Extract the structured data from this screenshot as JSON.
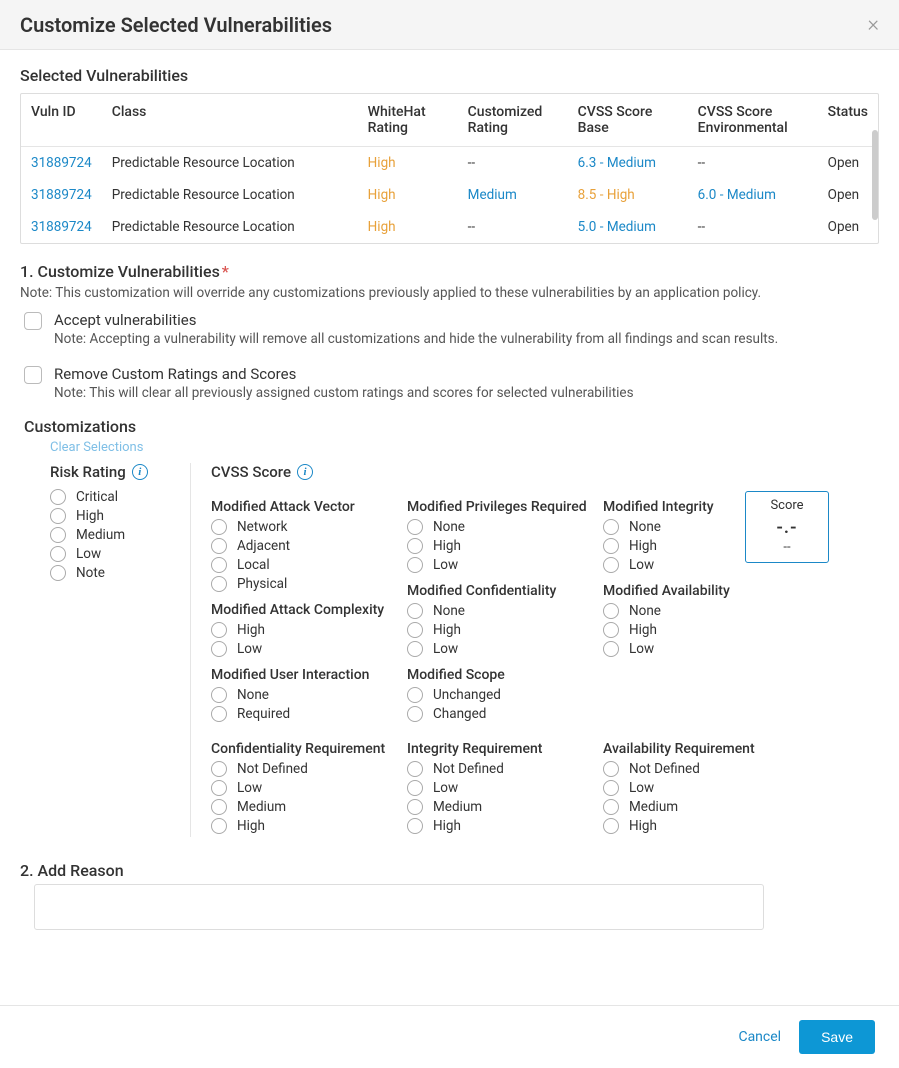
{
  "dialog_title": "Customize Selected Vulnerabilities",
  "selected_heading": "Selected Vulnerabilities",
  "table": {
    "headers": {
      "vuln_id": "Vuln ID",
      "class": "Class",
      "whitehat_rating": "WhiteHat Rating",
      "customized_rating": "Customized Rating",
      "cvss_base": "CVSS Score Base",
      "cvss_env": "CVSS Score Environmental",
      "status": "Status"
    },
    "rows": [
      {
        "id": "31889724",
        "class": "Predictable Resource Location",
        "wh": "High",
        "cust": "--",
        "base": "6.3 - Medium",
        "env": "--",
        "status": "Open"
      },
      {
        "id": "31889724",
        "class": "Predictable Resource Location",
        "wh": "High",
        "cust": "Medium",
        "base": "8.5 - High",
        "env": "6.0 - Medium",
        "status": "Open"
      },
      {
        "id": "31889724",
        "class": "Predictable Resource Location",
        "wh": "High",
        "cust": "--",
        "base": "5.0 - Medium",
        "env": "--",
        "status": "Open"
      }
    ]
  },
  "step1_title": "1. Customize Vulnerabilities",
  "step1_note": "Note: This customization will override any customizations previously applied to these vulnerabilities by an application policy.",
  "accept": {
    "label": "Accept vulnerabilities",
    "note": "Note:  Accepting a vulnerability will remove all customizations and hide the vulnerability from all findings and scan results."
  },
  "remove": {
    "label": "Remove Custom Ratings and Scores",
    "note": "Note:  This will clear all previously assigned custom ratings and scores for selected vulnerabilities"
  },
  "customizations_heading": "Customizations",
  "clear_selections": "Clear Selections",
  "risk_rating_title": "Risk Rating",
  "risk_options": [
    "Critical",
    "High",
    "Medium",
    "Low",
    "Note"
  ],
  "cvss_title": "CVSS Score",
  "score_box": {
    "label": "Score",
    "value": "-.-",
    "sub": "--"
  },
  "metrics": {
    "mav": {
      "title": "Modified Attack Vector",
      "opts": [
        "Network",
        "Adjacent",
        "Local",
        "Physical"
      ]
    },
    "mac": {
      "title": "Modified Attack Complexity",
      "opts": [
        "High",
        "Low"
      ]
    },
    "mui": {
      "title": "Modified User Interaction",
      "opts": [
        "None",
        "Required"
      ]
    },
    "mpr": {
      "title": "Modified Privileges Required",
      "opts": [
        "None",
        "High",
        "Low"
      ]
    },
    "mc": {
      "title": "Modified Confidentiality",
      "opts": [
        "None",
        "High",
        "Low"
      ]
    },
    "ms": {
      "title": "Modified Scope",
      "opts": [
        "Unchanged",
        "Changed"
      ]
    },
    "mi": {
      "title": "Modified Integrity",
      "opts": [
        "None",
        "High",
        "Low"
      ]
    },
    "ma": {
      "title": "Modified Availability",
      "opts": [
        "None",
        "High",
        "Low"
      ]
    },
    "cr": {
      "title": "Confidentiality Requirement",
      "opts": [
        "Not Defined",
        "Low",
        "Medium",
        "High"
      ]
    },
    "ir": {
      "title": "Integrity Requirement",
      "opts": [
        "Not Defined",
        "Low",
        "Medium",
        "High"
      ]
    },
    "ar": {
      "title": "Availability Requirement",
      "opts": [
        "Not Defined",
        "Low",
        "Medium",
        "High"
      ]
    }
  },
  "step2_title": "2. Add Reason",
  "footer": {
    "cancel": "Cancel",
    "save": "Save"
  }
}
